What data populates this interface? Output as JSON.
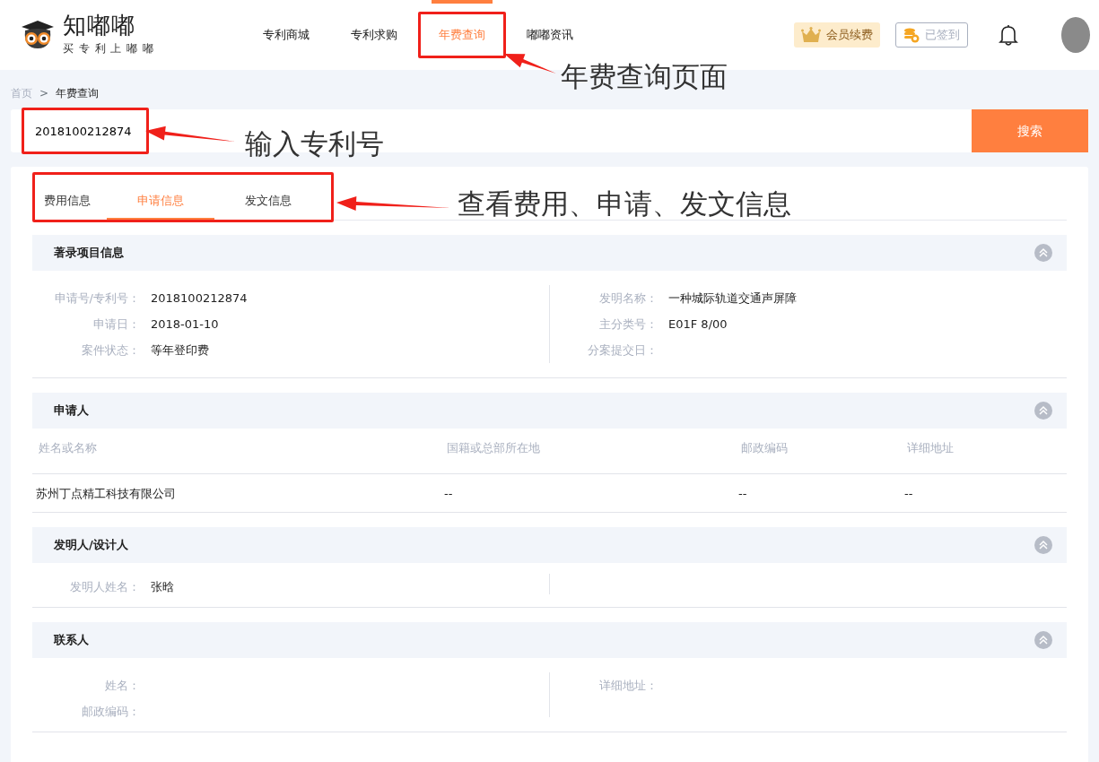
{
  "header": {
    "logo": {
      "name": "知嘟嘟",
      "slogan": "买 专 利 上 嘟 嘟"
    },
    "nav": [
      {
        "label": "专利商城",
        "selected": false,
        "highlighted": false
      },
      {
        "label": "专利求购",
        "selected": false,
        "highlighted": false
      },
      {
        "label": "年费查询",
        "selected": true,
        "highlighted": true
      },
      {
        "label": "嘟嘟资讯",
        "selected": false,
        "highlighted": false
      }
    ],
    "vip_button": "会员续费",
    "signin_button": "已签到"
  },
  "breadcrumb": {
    "items": [
      "首页",
      "年费查询"
    ],
    "separator": ">"
  },
  "search": {
    "value": "2018100212874",
    "highlighted": true,
    "button": "搜索"
  },
  "tabs": {
    "highlighted": true,
    "items": [
      {
        "label": "费用信息",
        "selected": false
      },
      {
        "label": "申请信息",
        "selected": true
      },
      {
        "label": "发文信息",
        "selected": false
      }
    ]
  },
  "sections": [
    {
      "title": "著录项目信息",
      "kind": "fields",
      "left": [
        {
          "label": "申请号/专利号：",
          "value": "2018100212874"
        },
        {
          "label": "申请日：",
          "value": "2018-01-10"
        },
        {
          "label": "案件状态：",
          "value": "等年登印费"
        }
      ],
      "right": [
        {
          "label": "发明名称：",
          "value": "一种城际轨道交通声屏障"
        },
        {
          "label": "主分类号：",
          "value": "E01F 8/00"
        },
        {
          "label": "分案提交日："
        }
      ]
    },
    {
      "title": "申请人",
      "kind": "table",
      "columns": [
        "姓名或名称",
        "国籍或总部所在地",
        "邮政编码",
        "详细地址"
      ],
      "rows": [
        [
          "苏州丁点精工科技有限公司",
          "--",
          "--",
          "--"
        ]
      ]
    },
    {
      "title": "发明人/设计人",
      "kind": "fields",
      "left": [
        {
          "label": "发明人姓名：",
          "value": "张晗"
        }
      ]
    },
    {
      "title": "联系人",
      "kind": "fields",
      "left": [
        {
          "label": "姓名："
        },
        {
          "label": "邮政编码："
        }
      ],
      "right": [
        {
          "label": "详细地址："
        }
      ]
    }
  ],
  "annotations": [
    {
      "text": "年费查询页面"
    },
    {
      "text": "输入专利号"
    },
    {
      "text": "查看费用、申请、发文信息"
    }
  ]
}
